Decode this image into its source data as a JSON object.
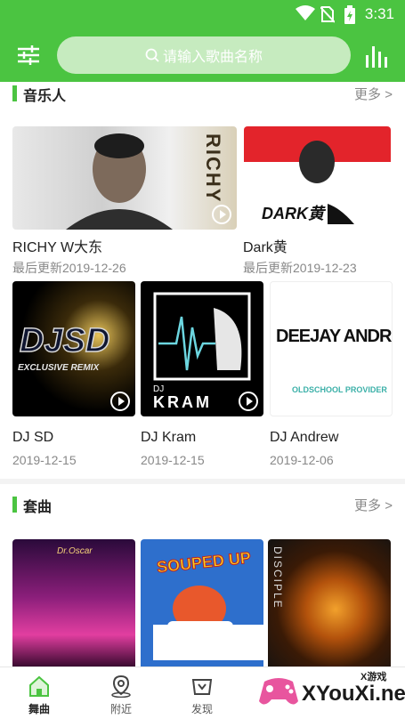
{
  "status": {
    "time": "3:31"
  },
  "search": {
    "placeholder": "请输入歌曲名称"
  },
  "musicians": {
    "title": "音乐人",
    "more": "更多",
    "featured": [
      {
        "name": "RICHY W大东",
        "date": "最后更新2019-12-26",
        "art_text": "RICHY"
      },
      {
        "name": "Dark黄",
        "date": "最后更新2019-12-23",
        "art_text": "DARK黄"
      }
    ],
    "grid": [
      {
        "name": "DJ SD",
        "date": "2019-12-15",
        "art_text": "DJSD",
        "art_sub": "EXCLUSIVE REMIX"
      },
      {
        "name": "DJ Kram",
        "date": "2019-12-15",
        "art_text": "KRAM",
        "art_small": "DJ"
      },
      {
        "name": "DJ Andrew",
        "date": "2019-12-06",
        "art_text": "DEEJAY ANDREW",
        "art_sub": "OLDSCHOOL PROVIDER"
      }
    ]
  },
  "sets": {
    "title": "套曲",
    "more": "更多",
    "art": [
      {
        "art_text": "Dr.Oscar"
      },
      {
        "art_text": "SOUPED UP"
      },
      {
        "art_text": "DISCIPLE"
      }
    ]
  },
  "tabs": [
    {
      "label": "舞曲",
      "icon": "home-icon"
    },
    {
      "label": "附近",
      "icon": "location-icon"
    },
    {
      "label": "发现",
      "icon": "discover-icon"
    }
  ],
  "watermark": {
    "text": "XYouXi.net",
    "sub": "X游戏"
  },
  "colors": {
    "accent": "#4bc441"
  }
}
